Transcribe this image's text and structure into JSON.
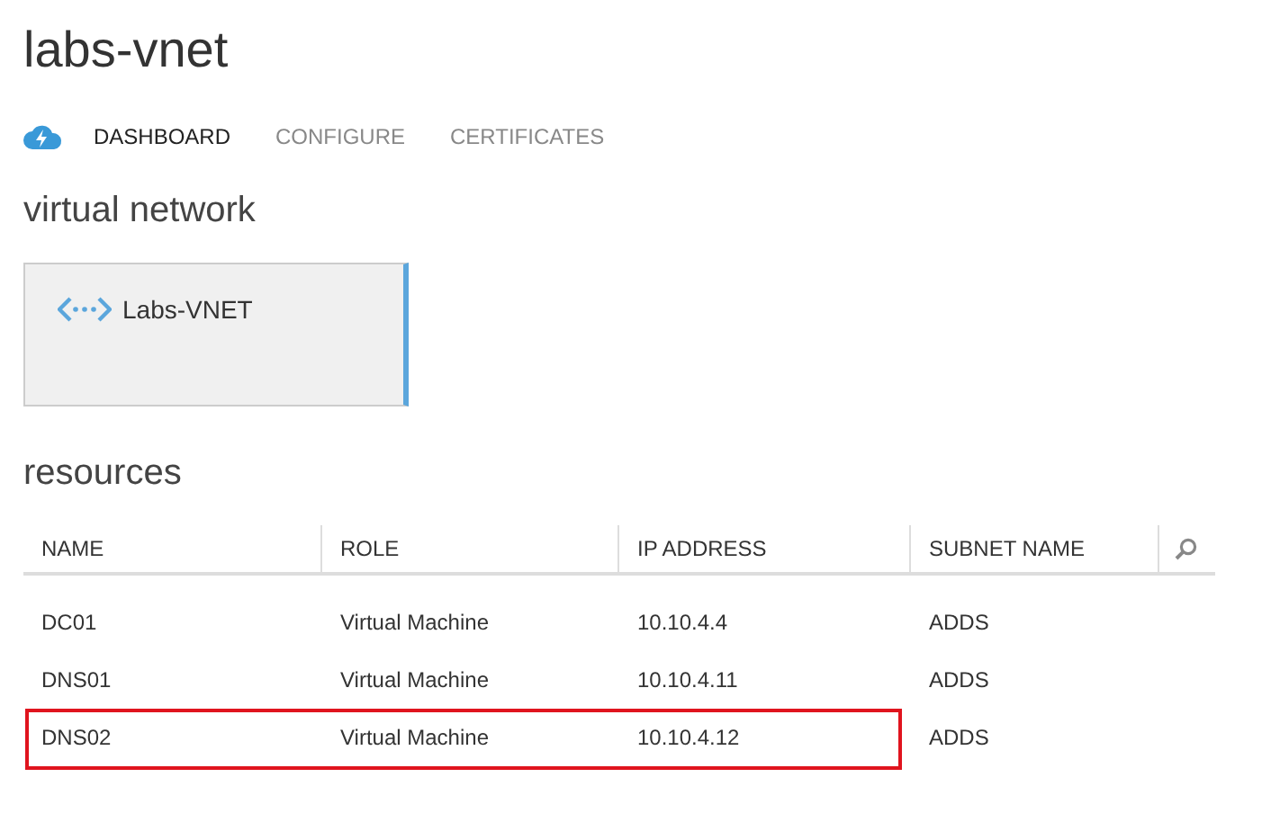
{
  "page": {
    "title": "labs-vnet"
  },
  "tabs": [
    {
      "label": "DASHBOARD",
      "selected": true
    },
    {
      "label": "CONFIGURE",
      "selected": false
    },
    {
      "label": "CERTIFICATES",
      "selected": false
    }
  ],
  "network_section": {
    "heading": "virtual network",
    "tile": {
      "label": "Labs-VNET"
    }
  },
  "resources": {
    "heading": "resources",
    "columns": [
      "NAME",
      "ROLE",
      "IP ADDRESS",
      "SUBNET NAME"
    ],
    "rows": [
      {
        "cells": [
          "DC01",
          "Virtual Machine",
          "10.10.4.4",
          "ADDS"
        ],
        "highlighted": false
      },
      {
        "cells": [
          "DNS01",
          "Virtual Machine",
          "10.10.4.11",
          "ADDS"
        ],
        "highlighted": false
      },
      {
        "cells": [
          "DNS02",
          "Virtual Machine",
          "10.10.4.12",
          "ADDS"
        ],
        "highlighted": true
      }
    ]
  }
}
